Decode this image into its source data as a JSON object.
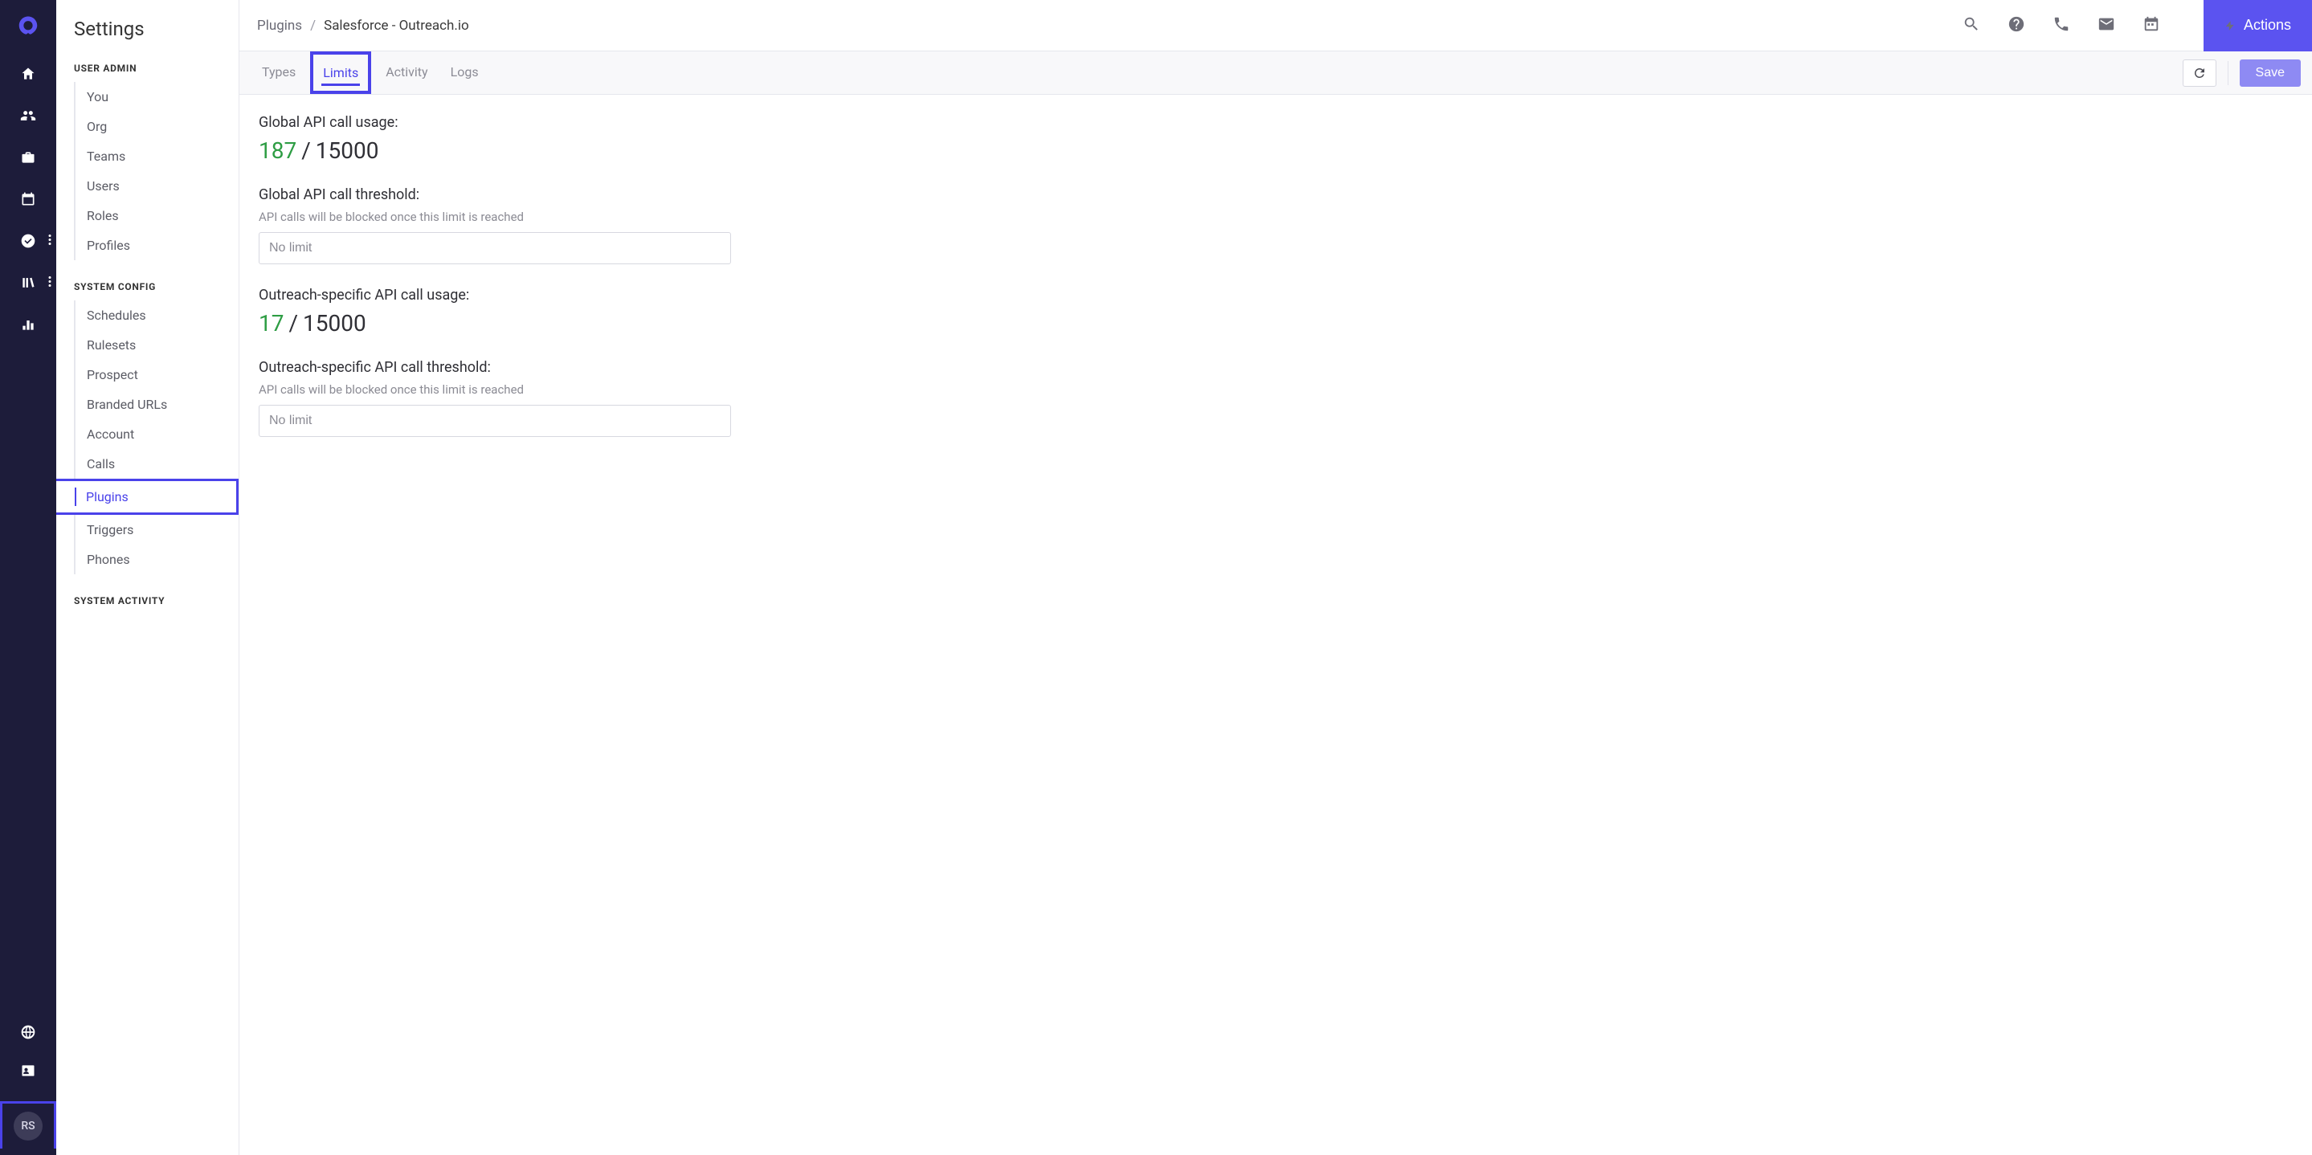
{
  "rail": {
    "avatar_initials": "RS"
  },
  "sidebar": {
    "title": "Settings",
    "sections": [
      {
        "label": "USER ADMIN",
        "items": [
          "You",
          "Org",
          "Teams",
          "Users",
          "Roles",
          "Profiles"
        ]
      },
      {
        "label": "SYSTEM CONFIG",
        "items": [
          "Schedules",
          "Rulesets",
          "Prospect",
          "Branded URLs",
          "Account",
          "Calls",
          "Plugins",
          "Triggers",
          "Phones"
        ],
        "active": "Plugins"
      },
      {
        "label": "SYSTEM ACTIVITY",
        "items": []
      }
    ]
  },
  "header": {
    "breadcrumb_root": "Plugins",
    "breadcrumb_current": "Salesforce - Outreach.io",
    "actions_label": "Actions"
  },
  "tabs": {
    "items": [
      "Types",
      "Limits",
      "Activity",
      "Logs"
    ],
    "active": "Limits",
    "save_label": "Save"
  },
  "limits": {
    "global_label": "Global API call usage:",
    "global_used": "187",
    "global_total": "15000",
    "global_threshold_label": "Global API call threshold:",
    "threshold_help": "API calls will be blocked once this limit is reached",
    "global_threshold_placeholder": "No limit",
    "outreach_label": "Outreach-specific API call usage:",
    "outreach_used": "17",
    "outreach_total": "15000",
    "outreach_threshold_label": "Outreach-specific API call threshold:",
    "outreach_threshold_placeholder": "No limit"
  }
}
